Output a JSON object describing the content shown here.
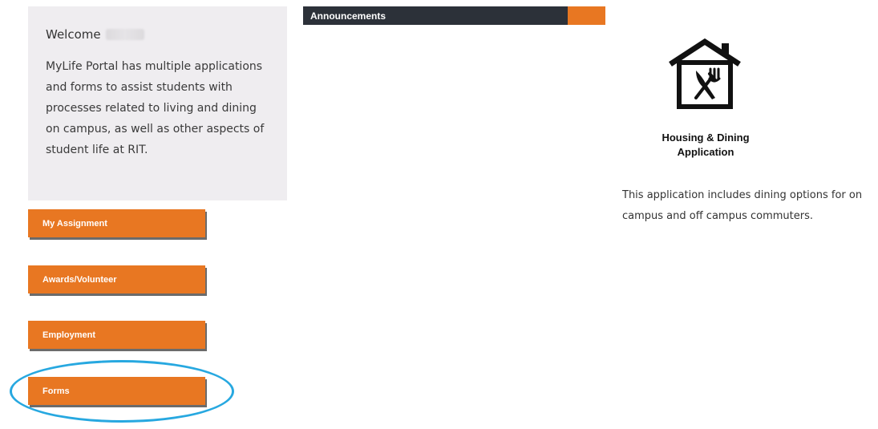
{
  "welcome": {
    "greeting": "Welcome",
    "description": "MyLife Portal has multiple applications and forms to assist students with processes related to living and dining on campus, as well as other aspects of student life at RIT."
  },
  "nav": {
    "my_assignment": "My Assignment",
    "awards_volunteer": "Awards/Volunteer",
    "employment": "Employment",
    "forms": "Forms"
  },
  "announcements": {
    "title": "Announcements"
  },
  "housing": {
    "icon": "house-utensils-icon",
    "title_line1": "Housing & Dining",
    "title_line2": "Application",
    "description": "This application includes dining options for on campus and off campus commuters."
  },
  "colors": {
    "accent_orange": "#e87722",
    "dark_bar": "#2c3139",
    "card_bg": "#efedf0",
    "highlight_ring": "#27a8e0"
  }
}
